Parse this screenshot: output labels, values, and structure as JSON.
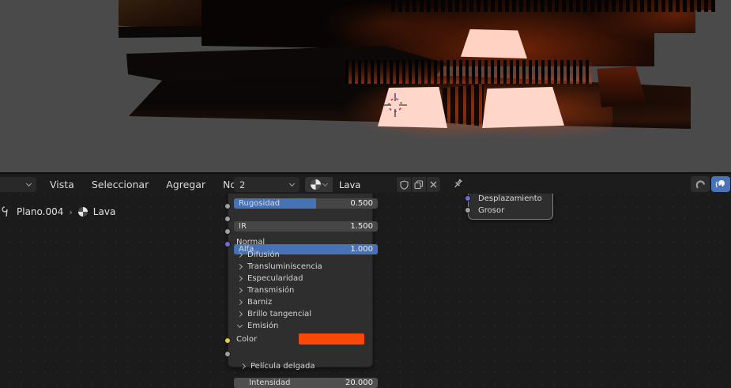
{
  "header": {
    "editor_type_dropdown": {
      "icon": "chevron-down-icon"
    },
    "menus": [
      {
        "label": "Vista"
      },
      {
        "label": "Seleccionar"
      },
      {
        "label": "Agregar"
      },
      {
        "label": "Nodo"
      }
    ],
    "slot_selector": {
      "value": "2",
      "icon": "chevron-down-icon"
    },
    "material_selector": {
      "browse_icon": "material-sphere-icon",
      "name": "Lava",
      "fake_user_icon": "shield-icon",
      "duplicate_icon": "copy-icon",
      "unlink_icon": "x-icon"
    },
    "pin_icon": "pin-icon",
    "right_buttons": [
      {
        "icon": "snap-magnet-icon",
        "active": false
      },
      {
        "icon": "render-preview-icon",
        "active": true
      }
    ]
  },
  "breadcrumb": {
    "context_icon": "wrench-icon",
    "object": "Plano.004",
    "separator": "›",
    "material_icon": "material-sphere-icon",
    "material": "Lava"
  },
  "nodes": {
    "principled": {
      "sliders": [
        {
          "label": "Rugosidad",
          "value": "0.500"
        },
        {
          "label": "IR",
          "value": "1.500"
        },
        {
          "label": "Alfa",
          "value": "1.000"
        }
      ],
      "normal": {
        "label": "Normal"
      },
      "sections": [
        {
          "label": "Difusión"
        },
        {
          "label": "Transluminiscencia"
        },
        {
          "label": "Especularidad"
        },
        {
          "label": "Transmisión"
        },
        {
          "label": "Barniz"
        },
        {
          "label": "Brillo tangencial"
        }
      ],
      "emission": {
        "label": "Emisión"
      },
      "color": {
        "label": "Color",
        "hex": "#fb4708"
      },
      "intensity": {
        "label": "Intensidad",
        "value": "20.000"
      },
      "film": {
        "label": "Película delgada"
      }
    },
    "output": {
      "inputs": [
        {
          "label": "Desplazamiento"
        },
        {
          "label": "Grosor"
        }
      ]
    }
  },
  "colors": {
    "accent_blue": "#4772b3",
    "emission_orange": "#fb4708",
    "emissive_plane": "#ffd6c9",
    "viewport_bg": "#4a4a4b",
    "canvas_bg": "#1b1b1b"
  }
}
